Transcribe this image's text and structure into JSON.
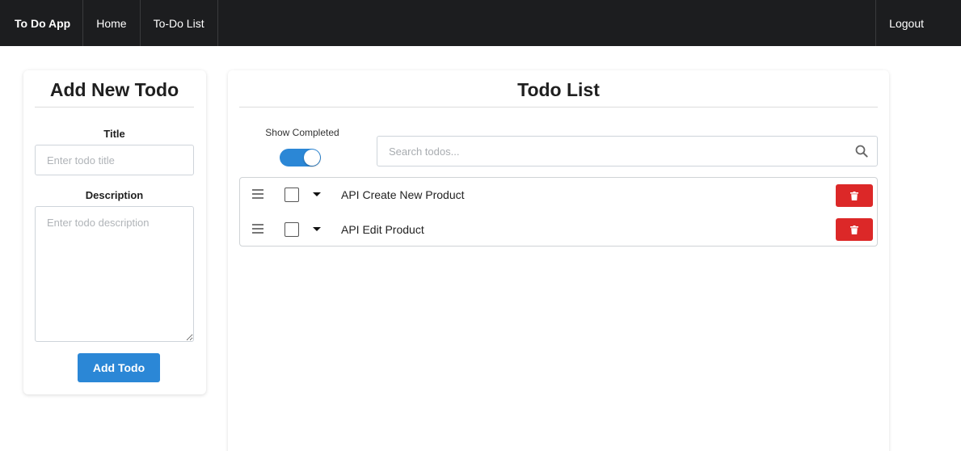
{
  "nav": {
    "brand": "To Do App",
    "items": [
      {
        "label": "Home"
      },
      {
        "label": "To-Do List"
      }
    ],
    "logout": "Logout"
  },
  "add_form": {
    "title": "Add New Todo",
    "title_label": "Title",
    "title_placeholder": "Enter todo title",
    "title_value": "",
    "description_label": "Description",
    "description_placeholder": "Enter todo description",
    "description_value": "",
    "submit_label": "Add Todo"
  },
  "todo_panel": {
    "title": "Todo List",
    "show_completed_label": "Show Completed",
    "show_completed": true,
    "search_placeholder": "Search todos...",
    "search_value": "",
    "todos": [
      {
        "text": "API Create New Product",
        "completed": false
      },
      {
        "text": "API Edit Product",
        "completed": false
      }
    ]
  },
  "colors": {
    "navbar": "#1c1d1f",
    "primary": "#2b87d6",
    "danger": "#dc2828"
  },
  "icons": [
    "search-icon",
    "drag-handle-icon",
    "caret-down-icon",
    "trash-icon"
  ]
}
